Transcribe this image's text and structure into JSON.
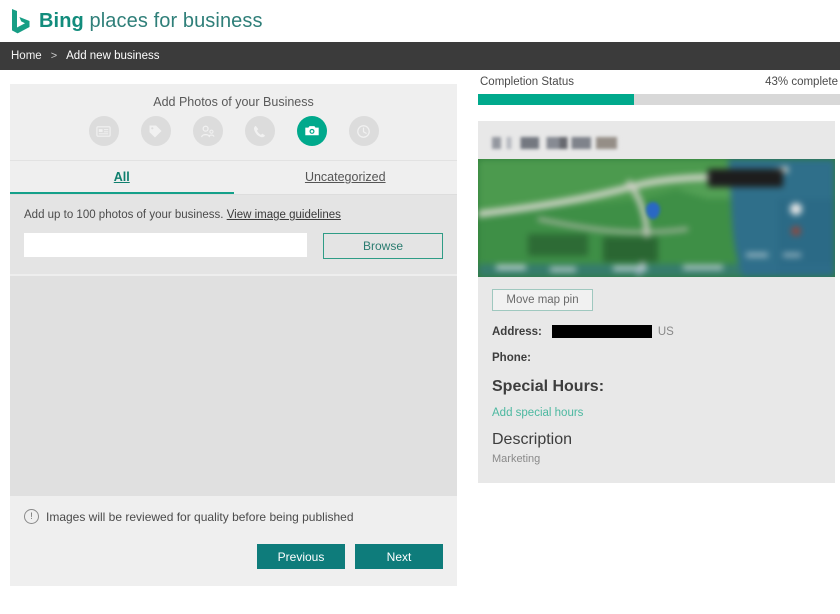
{
  "brand": {
    "logo_icon": "bing-logo-icon",
    "name_bold": "Bing",
    "name_light": " places for business"
  },
  "breadcrumb": {
    "home": "Home",
    "separator": ">",
    "current": "Add new business"
  },
  "left_panel": {
    "title": "Add Photos of your Business",
    "steps": [
      {
        "icon": "business-info-icon",
        "active": false
      },
      {
        "icon": "tag-icon",
        "active": false
      },
      {
        "icon": "profile-icon",
        "active": false
      },
      {
        "icon": "phone-icon",
        "active": false
      },
      {
        "icon": "camera-icon",
        "active": true
      },
      {
        "icon": "clock-icon",
        "active": false
      }
    ],
    "tabs": [
      {
        "label": "All",
        "active": true
      },
      {
        "label": "Uncategorized",
        "active": false
      }
    ],
    "upload": {
      "hint": "Add up to 100 photos of your business.",
      "guidelines_link": "View image guidelines",
      "file_value": "",
      "file_placeholder": "",
      "browse_label": "Browse"
    },
    "notice": {
      "icon": "exclamation-circle-icon",
      "text": "Images will be reviewed for quality before being published"
    },
    "actions": {
      "previous_label": "Previous",
      "next_label": "Next"
    }
  },
  "right_panel": {
    "completion": {
      "label": "Completion Status",
      "percent_text": "43% complete",
      "percent_value": 43
    },
    "business_name_redacted": "",
    "map": {
      "icon": "map-pin-icon",
      "move_pin_label": "Move map pin"
    },
    "details": {
      "address_label": "Address:",
      "address_redacted": "",
      "address_country": "US",
      "phone_label": "Phone:",
      "phone_value": "",
      "special_hours_label": "Special Hours:",
      "add_special_hours_link": "Add special hours",
      "description_heading": "Description",
      "description_body": "Marketing"
    }
  },
  "colors": {
    "accent_teal": "#00a98c",
    "button_teal": "#0e7c7b",
    "brand_green": "#128c7c",
    "breadcrumb_bar": "#3b3b3b"
  }
}
